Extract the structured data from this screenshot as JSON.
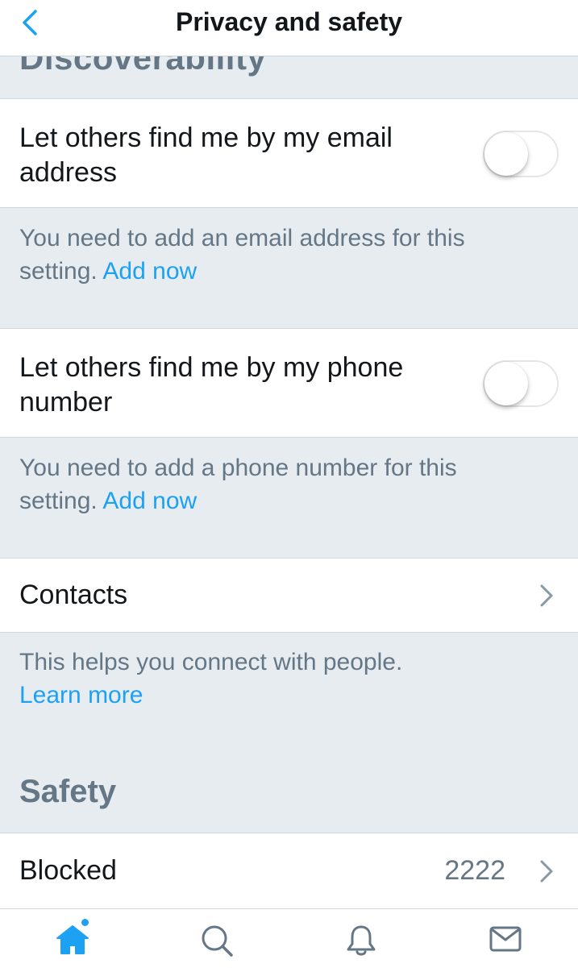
{
  "header": {
    "title": "Privacy and safety",
    "back_icon": "chevron-left-icon"
  },
  "discoverability": {
    "section_title": "Discoverability",
    "email_row": {
      "label": "Let others find me by my email address",
      "toggle_on": false
    },
    "email_note": {
      "text": "You need to add an email address for this setting.",
      "link": "Add now"
    },
    "phone_row": {
      "label": "Let others find me by my phone number",
      "toggle_on": false
    },
    "phone_note": {
      "text": "You need to add a phone number for this setting.",
      "link": "Add now"
    },
    "contacts_row": {
      "label": "Contacts"
    },
    "contacts_note": {
      "text": "This helps you connect with people.",
      "link": "Learn more"
    }
  },
  "safety": {
    "section_title": "Safety",
    "blocked_row": {
      "label": "Blocked",
      "count": "2222"
    }
  },
  "tabbar": {
    "tabs": [
      {
        "name": "home",
        "icon": "home-icon",
        "active": true,
        "has_dot": true
      },
      {
        "name": "search",
        "icon": "search-icon",
        "active": false
      },
      {
        "name": "notifications",
        "icon": "bell-icon",
        "active": false
      },
      {
        "name": "messages",
        "icon": "envelope-icon",
        "active": false
      }
    ]
  },
  "colors": {
    "accent": "#1da1f2",
    "background": "#e6ecf0",
    "secondary_text": "#657786",
    "icon_gray": "#657786"
  }
}
